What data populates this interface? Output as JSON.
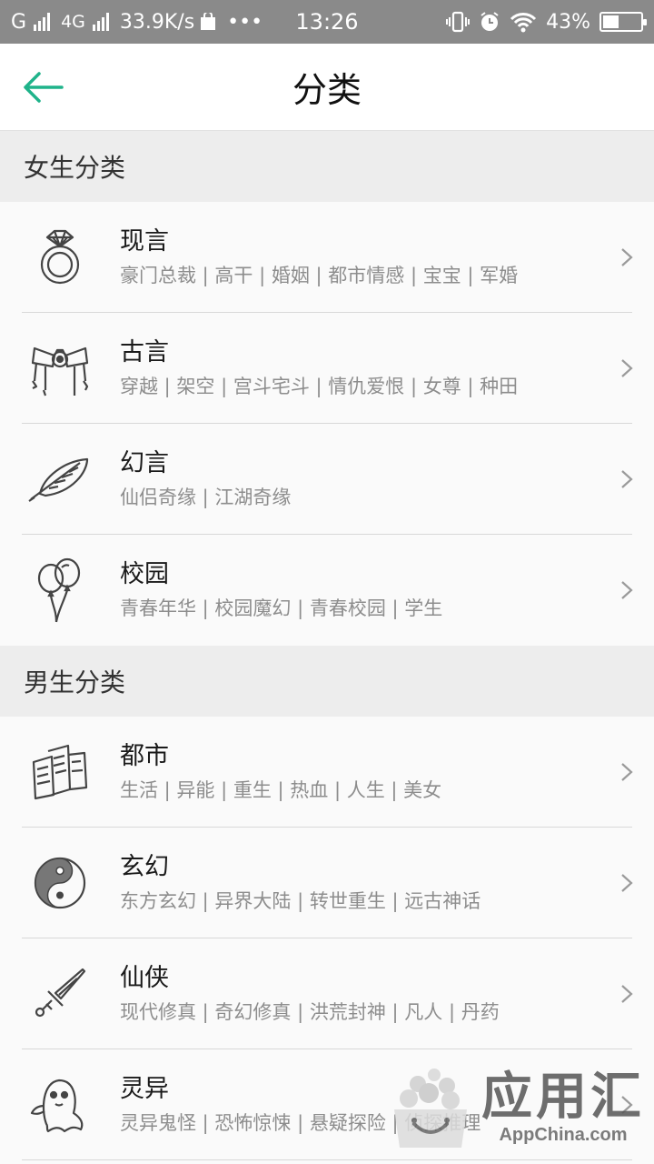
{
  "status_bar": {
    "carrier": "G",
    "network": "4G",
    "speed": "33.9K/s",
    "more": "•••",
    "time": "13:26",
    "battery_text": "43%",
    "battery_level": 0.43
  },
  "header": {
    "title": "分类"
  },
  "sections": [
    {
      "title": "女生分类",
      "items": [
        {
          "icon": "ring-icon",
          "title": "现言",
          "tags": "豪门总裁 | 高干 | 婚姻 | 都市情感 | 宝宝 | 军婚"
        },
        {
          "icon": "bow-icon",
          "title": "古言",
          "tags": "穿越 | 架空 | 宫斗宅斗 | 情仇爱恨 | 女尊 | 种田"
        },
        {
          "icon": "feather-icon",
          "title": "幻言",
          "tags": "仙侣奇缘 | 江湖奇缘"
        },
        {
          "icon": "balloons-icon",
          "title": "校园",
          "tags": "青春年华 | 校园魔幻 | 青春校园 | 学生"
        }
      ]
    },
    {
      "title": "男生分类",
      "items": [
        {
          "icon": "buildings-icon",
          "title": "都市",
          "tags": "生活 | 异能 | 重生 | 热血 | 人生 | 美女"
        },
        {
          "icon": "yin-yang-icon",
          "title": "玄幻",
          "tags": "东方玄幻 | 异界大陆 | 转世重生 | 远古神话"
        },
        {
          "icon": "sword-icon",
          "title": "仙侠",
          "tags": "现代修真 | 奇幻修真 | 洪荒封神 | 凡人 | 丹药"
        },
        {
          "icon": "ghost-icon",
          "title": "灵异",
          "tags": "灵异鬼怪 | 恐怖惊悚 | 悬疑探险 | 侦探推理"
        }
      ]
    }
  ],
  "watermark": {
    "title": "应用汇",
    "subtitle": "AppChina.com"
  },
  "colors": {
    "accent": "#1fb38a",
    "status_bar": "#8a8a8a",
    "section_bg": "#ededed"
  }
}
